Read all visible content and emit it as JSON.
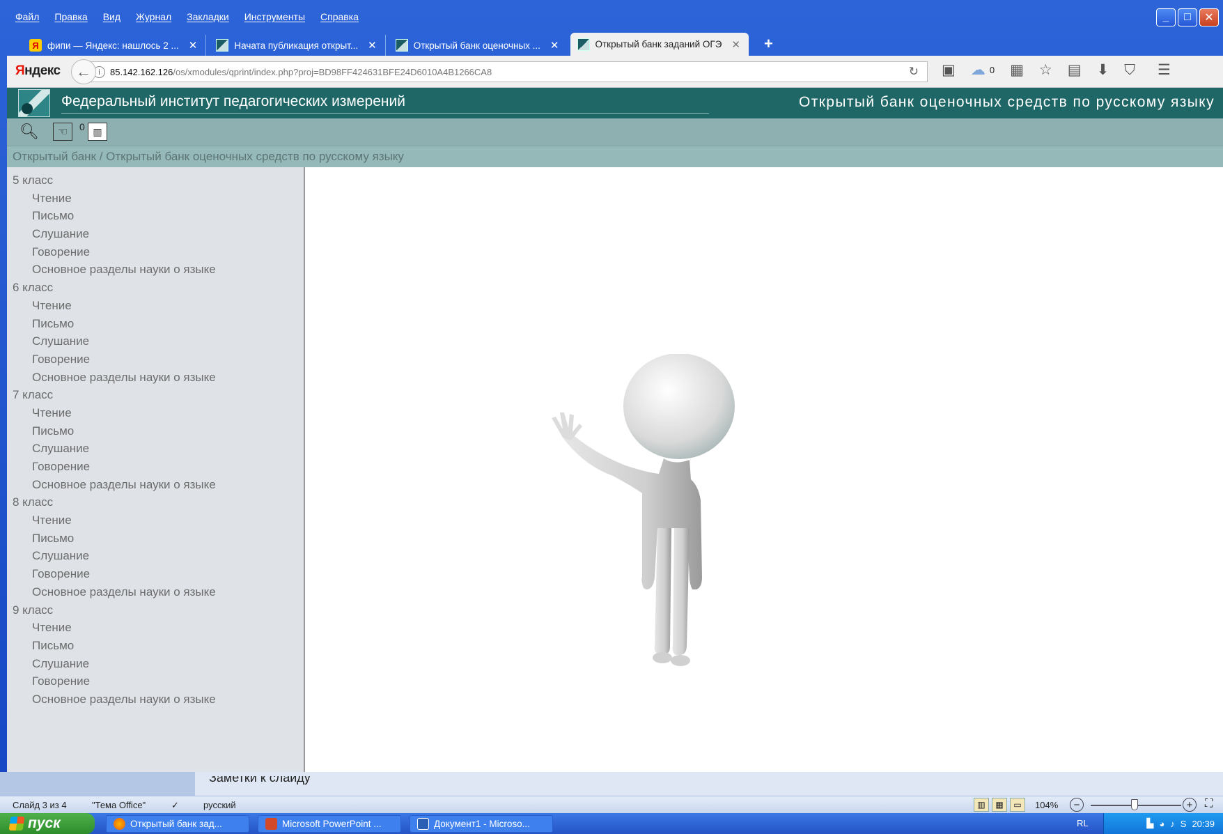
{
  "menu": [
    "Файл",
    "Правка",
    "Вид",
    "Журнал",
    "Закладки",
    "Инструменты",
    "Справка"
  ],
  "window_controls": {
    "minimize": "_",
    "maximize": "□",
    "close": "✕"
  },
  "tabs": [
    {
      "label": "фипи — Яндекс: нашлось 2 ...",
      "close": "✕",
      "icon": "yandex-icon"
    },
    {
      "label": "Начата публикация открыт...",
      "close": "✕",
      "icon": "fipi-icon"
    },
    {
      "label": "Открытый банк оценочных ...",
      "close": "✕",
      "icon": "fipi-icon"
    },
    {
      "label": "Открытый банк заданий ОГЭ",
      "close": "✕",
      "icon": "fipi-icon",
      "active": true
    }
  ],
  "new_tab": "+",
  "navbar": {
    "brand_first": "Я",
    "brand_rest": "ндекс",
    "url_host": "85.142.162.126",
    "url_path": "/os/xmodules/qprint/index.php?proj=BD98FF424631BFE24D6010A4B1266CA8",
    "cloud_count": "0"
  },
  "site": {
    "title": "Федеральный институт педагогических измерений",
    "subtitle": "Открытый банк оценочных средств по русскому языку"
  },
  "toolbar": {
    "count": "0"
  },
  "breadcrumb": "Открытый банк / Открытый банк оценочных средств по русскому языку",
  "sidebar": [
    {
      "title": "5 класс",
      "items": [
        "Чтение",
        "Письмо",
        "Слушание",
        "Говорение",
        "Основное разделы науки о языке"
      ]
    },
    {
      "title": "6 класс",
      "items": [
        "Чтение",
        "Письмо",
        "Слушание",
        "Говорение",
        "Основное разделы науки о языке"
      ]
    },
    {
      "title": "7 класс",
      "items": [
        "Чтение",
        "Письмо",
        "Слушание",
        "Говорение",
        "Основное разделы науки о языке"
      ]
    },
    {
      "title": "8 класс",
      "items": [
        "Чтение",
        "Письмо",
        "Слушание",
        "Говорение",
        "Основное разделы науки о языке"
      ]
    },
    {
      "title": "9 класс",
      "items": [
        "Чтение",
        "Письмо",
        "Слушание",
        "Говорение",
        "Основное разделы науки о языке"
      ]
    }
  ],
  "ppt": {
    "notes": "Заметки к слайду",
    "slide": "Слайд 3 из 4",
    "theme": "\"Тема Office\"",
    "language": "русский",
    "zoom": "104%"
  },
  "taskbar": {
    "start": "пуск",
    "buttons": [
      "Открытый банк зад...",
      "Microsoft PowerPoint ...",
      "Документ1 - Microso..."
    ],
    "lang": "RL",
    "clock": "20:39"
  }
}
